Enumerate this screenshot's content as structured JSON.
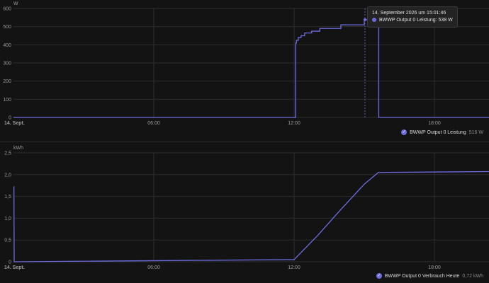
{
  "colors": {
    "line": "#6c6ce0",
    "grid": "#2c2c2c",
    "axis_text": "#9a9a9a",
    "background": "#131313"
  },
  "tooltip": {
    "title": "14. September 2026 um 15:01:46",
    "series": "BWWP Output 0 Leistung",
    "value": "538 W"
  },
  "chart_data": [
    {
      "type": "line",
      "ylabel": "W",
      "ylim": [
        0,
        600
      ],
      "yticks": [
        "0",
        "100",
        "200",
        "300",
        "400",
        "500",
        "600"
      ],
      "xlim": [
        "00:00",
        "20:20"
      ],
      "xticks": [
        {
          "t": 0,
          "label": "14. Sept."
        },
        {
          "t": 6,
          "label": "06:00"
        },
        {
          "t": 12,
          "label": "12:00"
        },
        {
          "t": 18,
          "label": "18:00"
        }
      ],
      "grid": true,
      "legend_position": "bottom-right",
      "hover_time": 15.03,
      "series": [
        {
          "name": "BWWP Output 0 Leistung",
          "legend_value": "516 W",
          "step": true,
          "x": [
            0,
            12.0,
            12.07,
            12.1,
            12.18,
            12.3,
            12.45,
            12.75,
            13.1,
            14.0,
            15.0,
            15.6,
            15.62,
            20.33
          ],
          "y": [
            0,
            0,
            410,
            425,
            440,
            450,
            465,
            475,
            490,
            510,
            538,
            538,
            0,
            0
          ]
        }
      ]
    },
    {
      "type": "line",
      "ylabel": "kWh",
      "ylim": [
        0,
        2.5
      ],
      "yticks": [
        "0",
        "0,5",
        "1,0",
        "1,5",
        "2,0",
        "2,5"
      ],
      "xlim": [
        "00:00",
        "20:20"
      ],
      "xticks": [
        {
          "t": 0,
          "label": "14. Sept."
        },
        {
          "t": 6,
          "label": "06:00"
        },
        {
          "t": 12,
          "label": "12:00"
        },
        {
          "t": 18,
          "label": "18:00"
        }
      ],
      "grid": true,
      "legend_position": "bottom-right",
      "series": [
        {
          "name": "BWWP Output 0 Verbrauch Heute",
          "legend_value": "0,72 kWh",
          "step": false,
          "x": [
            0,
            0.02,
            0.03,
            12.0,
            13.0,
            14.0,
            15.0,
            15.6,
            20.33
          ],
          "y": [
            1.72,
            1.72,
            0,
            0.05,
            0.6,
            1.2,
            1.78,
            2.05,
            2.07
          ]
        }
      ]
    }
  ]
}
